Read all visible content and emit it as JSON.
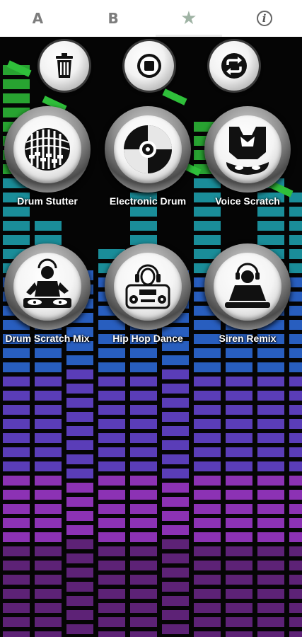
{
  "tabs": [
    {
      "label": "A",
      "icon": "letter-a-icon",
      "active": false
    },
    {
      "label": "B",
      "icon": "letter-b-icon",
      "active": false
    },
    {
      "label": "★",
      "icon": "star-icon",
      "active": true
    },
    {
      "label": "i",
      "icon": "info-icon",
      "active": false
    }
  ],
  "controls": [
    {
      "icon": "trash-icon"
    },
    {
      "icon": "stop-icon"
    },
    {
      "icon": "repeat-icon"
    }
  ],
  "sounds": [
    {
      "label": "Drum Stutter",
      "icon": "drum-stutter-icon"
    },
    {
      "label": "Electronic Drum",
      "icon": "vinyl-disc-icon"
    },
    {
      "label": "Voice Scratch",
      "icon": "dj-mask-icon"
    },
    {
      "label": "Drum Scratch Mix",
      "icon": "dj-turntables-icon"
    },
    {
      "label": "Hip Hop Dance",
      "icon": "boombox-dj-icon"
    },
    {
      "label": "Siren Remix",
      "icon": "dj-headphones-icon"
    }
  ],
  "colors": {
    "tab_active": "#9fb3a4",
    "tab_inactive": "#7d7d7d",
    "eq_green": "#2fbf3a",
    "eq_teal": "#1fa6b4",
    "eq_blue": "#2f6fe0",
    "eq_purple": "#a53bd4"
  }
}
